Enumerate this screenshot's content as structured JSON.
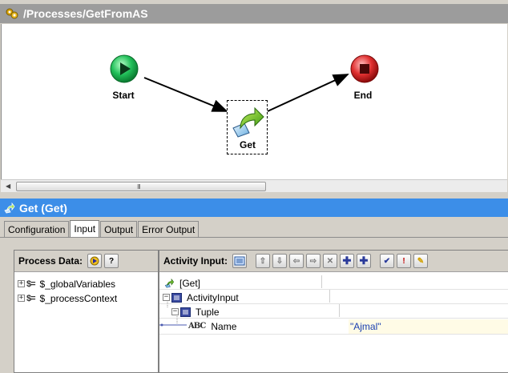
{
  "process": {
    "title": "/Processes/GetFromAS",
    "nodes": {
      "start": "Start",
      "get": "Get",
      "end": "End"
    },
    "scroll_grip": "III"
  },
  "activity": {
    "title": "Get (Get)",
    "tabs": [
      "Configuration",
      "Input",
      "Output",
      "Error Output"
    ],
    "active_tab": "Input"
  },
  "process_data": {
    "label": "Process Data:",
    "items": [
      "$_globalVariables",
      "$_processContext"
    ]
  },
  "activity_input": {
    "label": "Activity Input:",
    "rows": [
      {
        "label": "[Get]",
        "value": ""
      },
      {
        "label": "ActivityInput",
        "value": ""
      },
      {
        "label": "Tuple",
        "value": ""
      },
      {
        "label": "Name",
        "value": "\"Ajmal\""
      }
    ]
  },
  "colors": {
    "header_blue": "#3c8ee8",
    "title_gray": "#9c9c9c",
    "start_green": "#22c05a",
    "end_red": "#e03030"
  }
}
